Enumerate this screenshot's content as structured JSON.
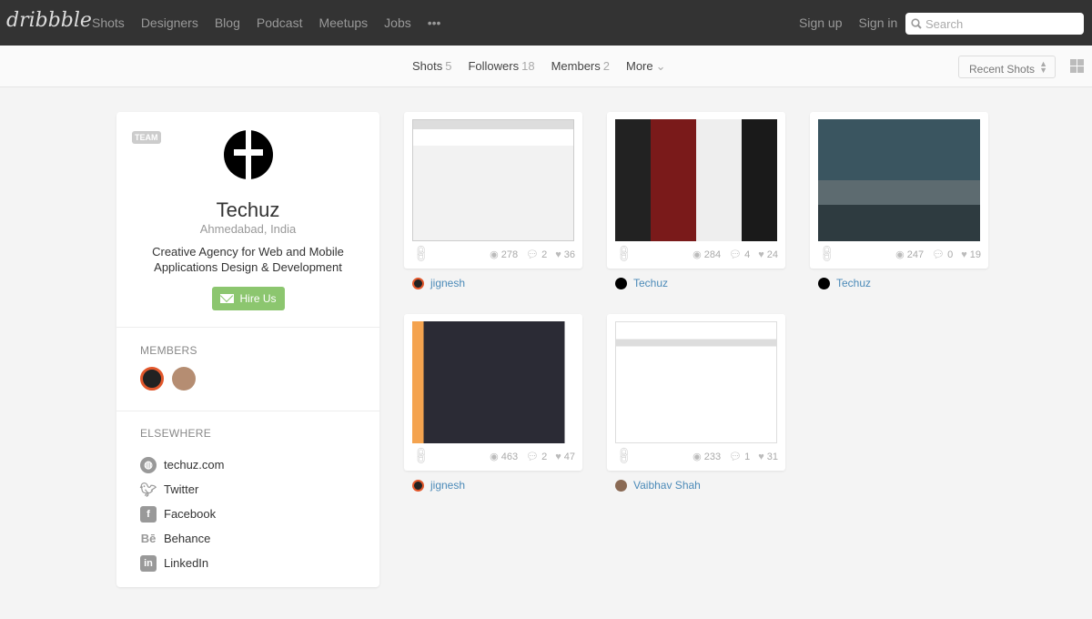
{
  "header": {
    "logo": "dribbble",
    "nav": [
      "Shots",
      "Designers",
      "Blog",
      "Podcast",
      "Meetups",
      "Jobs",
      "•••"
    ],
    "sign_up": "Sign up",
    "sign_in": "Sign in",
    "search_placeholder": "Search"
  },
  "subnav": {
    "tabs": [
      {
        "label": "Shots",
        "count": "5"
      },
      {
        "label": "Followers",
        "count": "18"
      },
      {
        "label": "Members",
        "count": "2"
      },
      {
        "label": "More",
        "count": ""
      }
    ],
    "sort": "Recent Shots"
  },
  "profile": {
    "badge": "TEAM",
    "name": "Techuz",
    "location": "Ahmedabad, India",
    "bio": "Creative Agency for Web and Mobile Applications Design & Development",
    "hire": "Hire Us",
    "members_title": "MEMBERS",
    "elsewhere_title": "ELSEWHERE",
    "links": [
      {
        "icon": "globe-icon",
        "label": "techuz.com"
      },
      {
        "icon": "twitter-icon",
        "label": "Twitter"
      },
      {
        "icon": "facebook-icon",
        "label": "Facebook"
      },
      {
        "icon": "behance-icon",
        "label": "Behance"
      },
      {
        "icon": "linkedin-icon",
        "label": "LinkedIn"
      }
    ]
  },
  "shots": [
    {
      "views": "278",
      "comments": "2",
      "likes": "36",
      "author": "jignesh"
    },
    {
      "views": "284",
      "comments": "4",
      "likes": "24",
      "author": "Techuz"
    },
    {
      "views": "247",
      "comments": "0",
      "likes": "19",
      "author": "Techuz"
    },
    {
      "views": "463",
      "comments": "2",
      "likes": "47",
      "author": "jignesh"
    },
    {
      "views": "233",
      "comments": "1",
      "likes": "31",
      "author": "Vaibhav Shah"
    }
  ],
  "colors": {
    "topbar": "#333333",
    "hire": "#8cc66f",
    "link": "#4b8ab8"
  }
}
